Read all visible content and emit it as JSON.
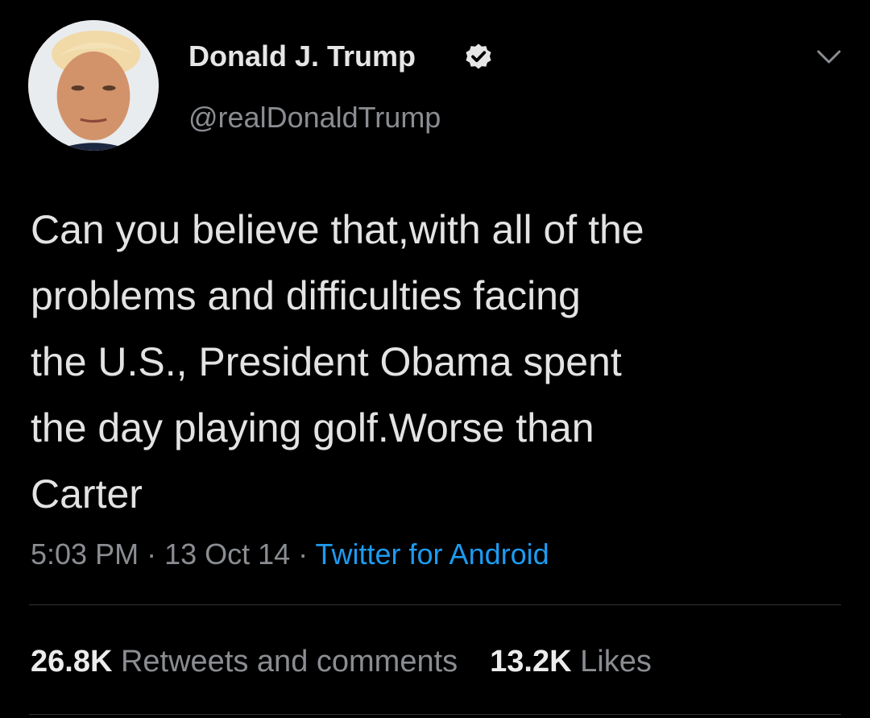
{
  "user": {
    "display_name": "Donald J. Trump",
    "handle": "@realDonaldTrump",
    "verified_icon": "verified-badge-icon"
  },
  "tweet": {
    "text": "Can you believe that,with all of the\nproblems and difficulties facing\nthe U.S., President Obama spent\nthe day playing golf.Worse than\nCarter",
    "time": "5:03 PM",
    "separator": " · ",
    "date": "13 Oct 14",
    "source": "Twitter for Android"
  },
  "stats": {
    "retweets_count": "26.8K",
    "retweets_label": "Retweets and comments",
    "likes_count": "13.2K",
    "likes_label": "Likes"
  },
  "colors": {
    "background": "#000000",
    "link_blue": "#1d9bf0",
    "secondary_text": "#8a8d91",
    "primary_text": "#e3e3e3"
  }
}
